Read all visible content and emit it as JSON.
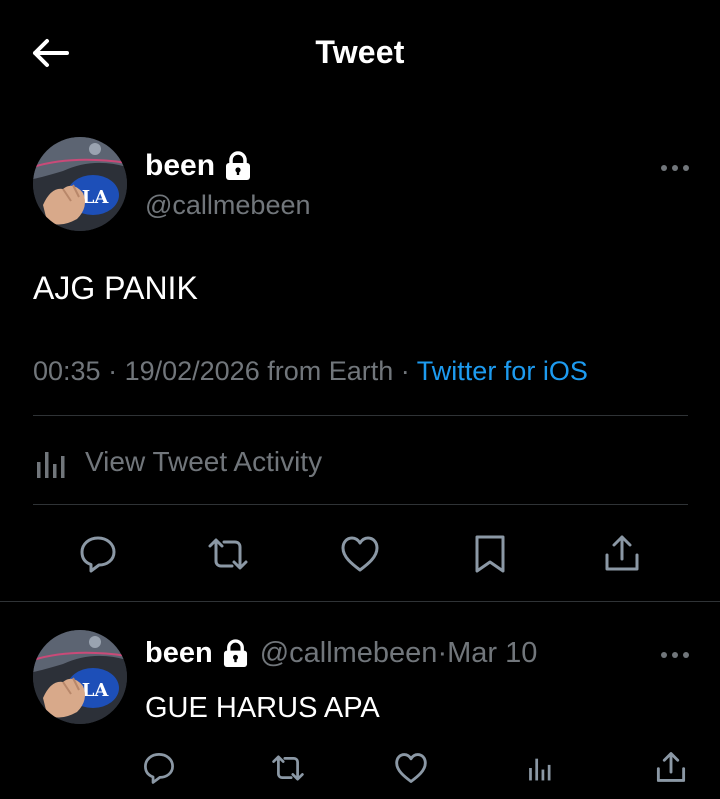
{
  "header": {
    "title": "Tweet",
    "back_icon": "arrow-left-icon"
  },
  "main_tweet": {
    "author_name": "been",
    "author_handle": "@callmebeen",
    "protected_icon": "lock-icon",
    "text": "AJG PANIK",
    "time": "00:35",
    "date": "19/02/2026",
    "separator": " · ",
    "location": "from Earth",
    "source": "Twitter for iOS",
    "activity_label": "View Tweet Activity",
    "actions": [
      "reply-icon",
      "retweet-icon",
      "like-icon",
      "bookmark-icon",
      "share-icon"
    ]
  },
  "reply": {
    "author_name": "been",
    "author_handle": "@callmebeen",
    "separator": " · ",
    "date": "Mar 10",
    "text": "GUE HARUS APA",
    "actions": [
      "reply-icon",
      "retweet-icon",
      "like-icon",
      "analytics-icon",
      "share-icon"
    ]
  },
  "colors": {
    "background": "#000000",
    "text": "#ffffff",
    "muted": "#71767b",
    "link": "#1d9bf0",
    "divider": "#2f3336"
  }
}
